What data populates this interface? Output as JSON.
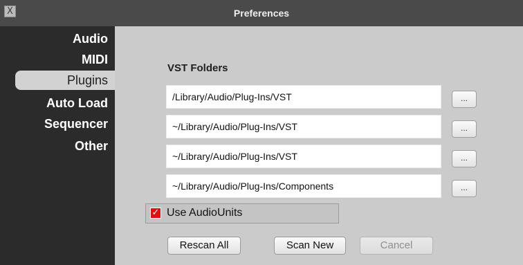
{
  "window": {
    "title": "Preferences",
    "close_label": "X"
  },
  "sidebar": {
    "items": [
      {
        "label": "Audio",
        "selected": false
      },
      {
        "label": "MIDI",
        "selected": false
      },
      {
        "label": "Plugins",
        "selected": true
      },
      {
        "label": "Auto Load",
        "selected": false
      },
      {
        "label": "Sequencer",
        "selected": false
      },
      {
        "label": "Other",
        "selected": false
      }
    ]
  },
  "plugins": {
    "section_title": "VST Folders",
    "folders": [
      "/Library/Audio/Plug-Ins/VST",
      "~/Library/Audio/Plug-Ins/VST",
      "~/Library/Audio/Plug-Ins/VST",
      "~/Library/Audio/Plug-Ins/Components"
    ],
    "browse_label": "...",
    "use_audiounits": {
      "label": "Use AudioUnits",
      "checked": true,
      "check_glyph": "✓"
    },
    "buttons": {
      "rescan_all": "Rescan All",
      "scan_new": "Scan New",
      "cancel": "Cancel"
    }
  },
  "colors": {
    "sidebar_bg": "#2b2b2b",
    "panel_bg": "#cbcbcb",
    "checkbox": "#e01010"
  }
}
